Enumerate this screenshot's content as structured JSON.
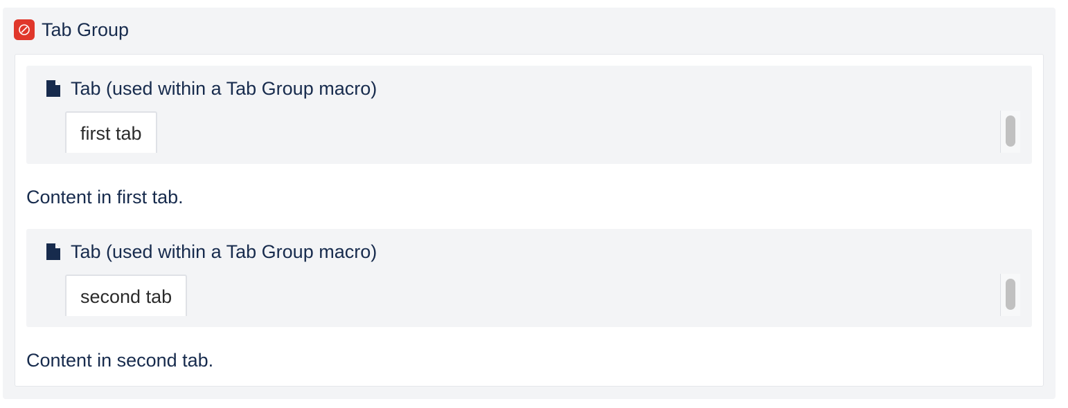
{
  "macro": {
    "title": "Tab Group",
    "icon": "tab-group-macro-icon",
    "accent_color": "#e0372b"
  },
  "tabs": [
    {
      "heading": "Tab (used within a Tab Group macro)",
      "icon": "document-icon",
      "tab_label": "first tab",
      "content": "Content in first tab."
    },
    {
      "heading": "Tab (used within a Tab Group macro)",
      "icon": "document-icon",
      "tab_label": "second tab",
      "content": "Content in second tab."
    }
  ]
}
